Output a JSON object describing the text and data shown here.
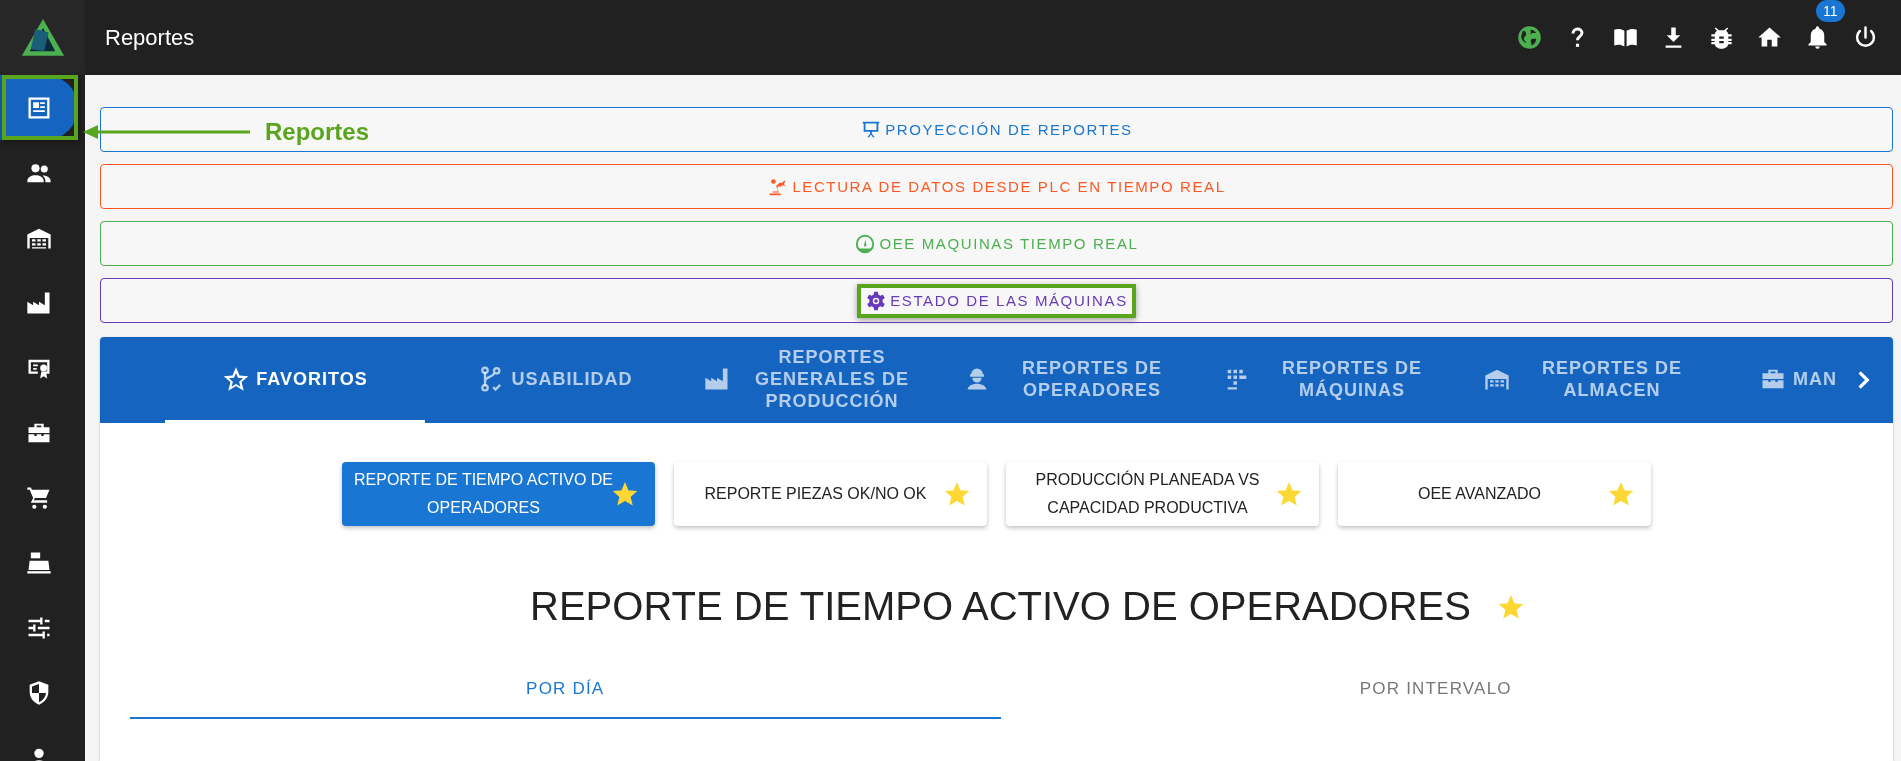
{
  "top_bar": {
    "title": "Reportes",
    "notification_count": "11"
  },
  "sidebar": {
    "items": [
      {
        "selected": true,
        "highlighted": true
      },
      {
        "selected": false,
        "highlighted": false
      },
      {
        "selected": false,
        "highlighted": false
      },
      {
        "selected": false,
        "highlighted": false
      },
      {
        "selected": false,
        "highlighted": false
      },
      {
        "selected": false,
        "highlighted": false
      },
      {
        "selected": false,
        "highlighted": false
      },
      {
        "selected": false,
        "highlighted": false
      },
      {
        "selected": false,
        "highlighted": false
      },
      {
        "selected": false,
        "highlighted": false
      },
      {
        "selected": false,
        "highlighted": false
      }
    ]
  },
  "annotation": {
    "label": "Reportes"
  },
  "quick_buttons": [
    {
      "label": "PROYECCIÓN DE REPORTES",
      "color": "#1976d2",
      "highlighted": false
    },
    {
      "label": "LECTURA DE DATOS DESDE PLC EN TIEMPO REAL",
      "color": "#ff5722",
      "highlighted": false
    },
    {
      "label": "OEE MAQUINAS TIEMPO REAL",
      "color": "#4caf50",
      "highlighted": false
    },
    {
      "label": "ESTADO DE LAS MÁQUINAS",
      "color": "#673ab7",
      "highlighted": true
    }
  ],
  "tabs": [
    {
      "label": "FAVORITOS",
      "selected": true
    },
    {
      "label": "USABILIDAD",
      "selected": false
    },
    {
      "label": "REPORTES GENERALES DE PRODUCCIÓN",
      "selected": false
    },
    {
      "label": "REPORTES DE OPERADORES",
      "selected": false
    },
    {
      "label": "REPORTES DE MÁQUINAS",
      "selected": false
    },
    {
      "label": "REPORTES DE ALMACEN",
      "selected": false
    },
    {
      "label": "MAN",
      "selected": false
    }
  ],
  "favorites": [
    {
      "label": "REPORTE DE TIEMPO ACTIVO DE OPERADORES",
      "selected": true,
      "starred": true
    },
    {
      "label": "REPORTE PIEZAS OK/NO OK",
      "selected": false,
      "starred": true
    },
    {
      "label": "PRODUCCIÓN PLANEADA VS CAPACIDAD PRODUCTIVA",
      "selected": false,
      "starred": true
    },
    {
      "label": "OEE AVANZADO",
      "selected": false,
      "starred": true
    }
  ],
  "report": {
    "title": "REPORTE DE TIEMPO ACTIVO DE OPERADORES",
    "starred": true,
    "tabs": [
      {
        "label": "POR DÍA",
        "selected": true
      },
      {
        "label": "POR INTERVALO",
        "selected": false
      }
    ]
  }
}
